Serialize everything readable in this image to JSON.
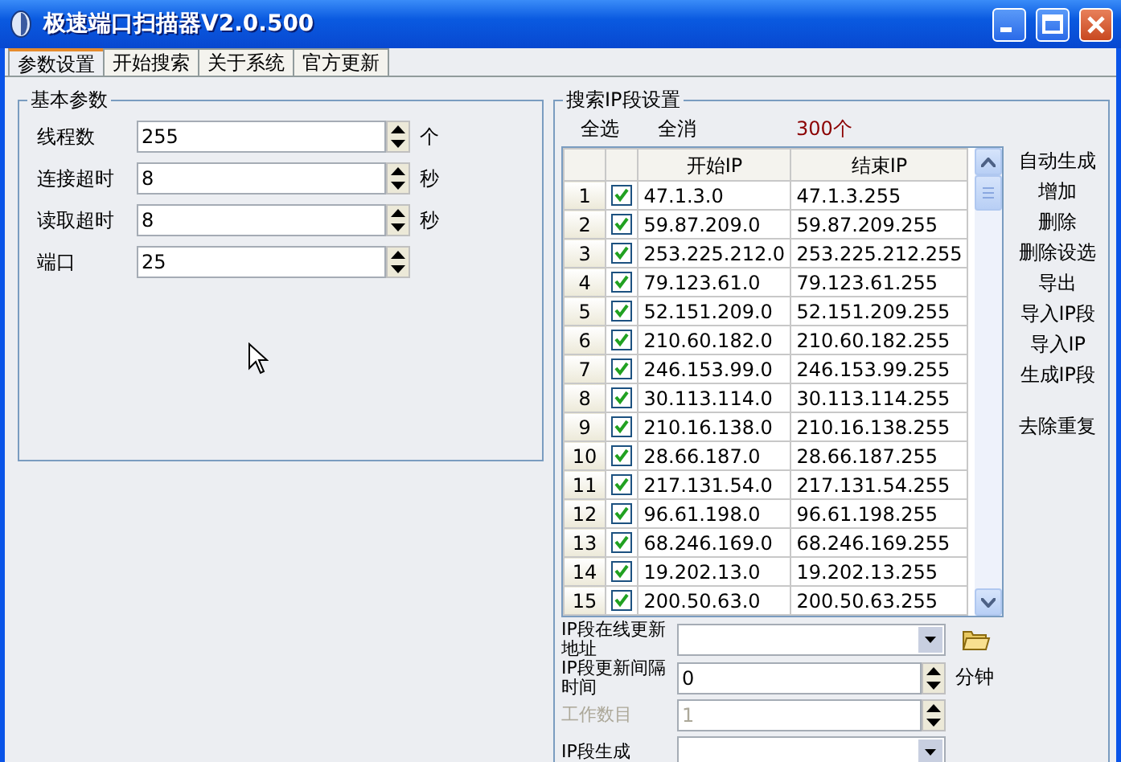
{
  "window": {
    "title": "极速端口扫描器V2.0.500"
  },
  "tabs": [
    {
      "label": "参数设置",
      "selected": true
    },
    {
      "label": "开始搜索",
      "selected": false
    },
    {
      "label": "关于系统",
      "selected": false
    },
    {
      "label": "官方更新",
      "selected": false
    }
  ],
  "basic_params": {
    "title": "基本参数",
    "fields": [
      {
        "label": "线程数",
        "value": "255",
        "unit": "个"
      },
      {
        "label": "连接超时",
        "value": "8",
        "unit": "秒"
      },
      {
        "label": "读取超时",
        "value": "8",
        "unit": "秒"
      },
      {
        "label": "端口",
        "value": "25"
      }
    ]
  },
  "ip_settings": {
    "title": "搜索IP段设置",
    "select_all": "全选",
    "deselect_all": "全消",
    "count": "300个",
    "table": {
      "columns": [
        "开始IP",
        "结束IP"
      ],
      "rows": [
        {
          "index": "1",
          "checked": true,
          "start": "47.1.3.0",
          "end": "47.1.3.255"
        },
        {
          "index": "2",
          "checked": true,
          "start": "59.87.209.0",
          "end": "59.87.209.255"
        },
        {
          "index": "3",
          "checked": true,
          "start": "253.225.212.0",
          "end": "253.225.212.255"
        },
        {
          "index": "4",
          "checked": true,
          "start": "79.123.61.0",
          "end": "79.123.61.255"
        },
        {
          "index": "5",
          "checked": true,
          "start": "52.151.209.0",
          "end": "52.151.209.255"
        },
        {
          "index": "6",
          "checked": true,
          "start": "210.60.182.0",
          "end": "210.60.182.255"
        },
        {
          "index": "7",
          "checked": true,
          "start": "246.153.99.0",
          "end": "246.153.99.255"
        },
        {
          "index": "8",
          "checked": true,
          "start": "30.113.114.0",
          "end": "30.113.114.255"
        },
        {
          "index": "9",
          "checked": true,
          "start": "210.16.138.0",
          "end": "210.16.138.255"
        },
        {
          "index": "10",
          "checked": true,
          "start": "28.66.187.0",
          "end": "28.66.187.255"
        },
        {
          "index": "11",
          "checked": true,
          "start": "217.131.54.0",
          "end": "217.131.54.255"
        },
        {
          "index": "12",
          "checked": true,
          "start": "96.61.198.0",
          "end": "96.61.198.255"
        },
        {
          "index": "13",
          "checked": true,
          "start": "68.246.169.0",
          "end": "68.246.169.255"
        },
        {
          "index": "14",
          "checked": true,
          "start": "19.202.13.0",
          "end": "19.202.13.255"
        },
        {
          "index": "15",
          "checked": true,
          "start": "200.50.63.0",
          "end": "200.50.63.255"
        }
      ]
    },
    "actions": [
      "自动生成",
      "增加",
      "删除",
      "删除设选",
      "导出",
      "导入IP段",
      "导入IP",
      "生成IP段"
    ],
    "extra_actions": [
      "去除重复"
    ],
    "fields": [
      {
        "kind": "combo",
        "label": "IP段在线更新地址",
        "disabled": false
      },
      {
        "kind": "spin",
        "label": "IP段更新间隔时间",
        "value": "0",
        "unit": "分钟",
        "disabled": false
      },
      {
        "kind": "spin",
        "label": "工作数目",
        "value": "1",
        "disabled": true
      },
      {
        "kind": "combo",
        "label": "IP段生成",
        "disabled": false
      }
    ]
  }
}
